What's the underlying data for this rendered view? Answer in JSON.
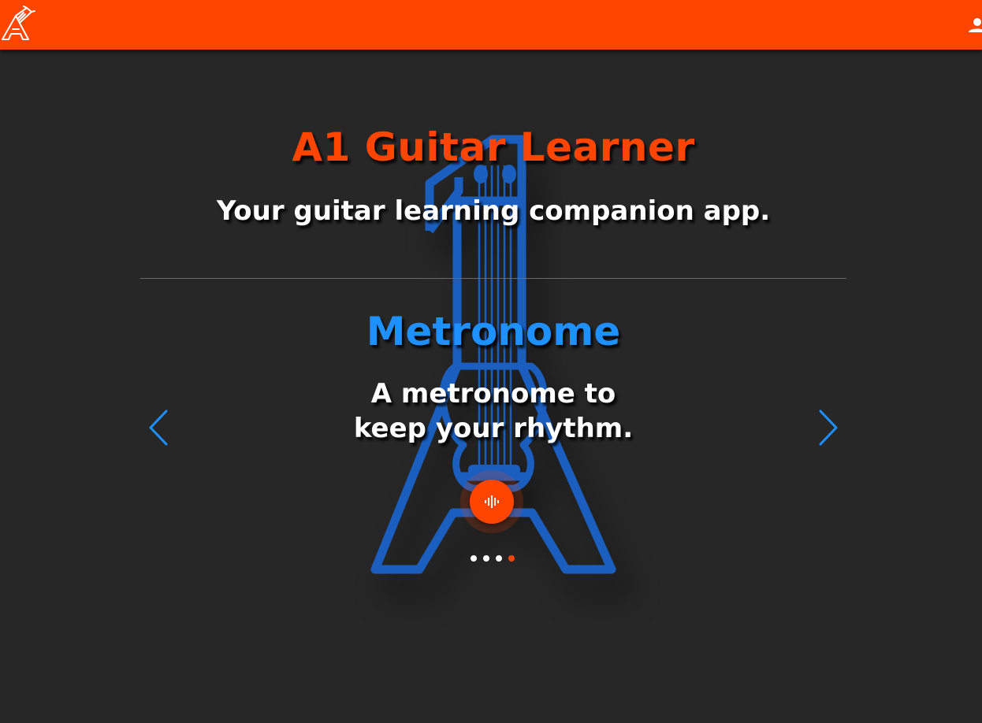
{
  "header": {
    "logo_icon": "guitar-a-logo-icon",
    "account_icon": "person-icon"
  },
  "hero": {
    "title": "A1 Guitar Learner",
    "subtitle": "Your guitar learning companion app."
  },
  "carousel": {
    "slide_title": "Metronome",
    "slide_description": "A metronome to keep your rhythm.",
    "prev_icon": "chevron-left-icon",
    "next_icon": "chevron-right-icon",
    "action_icon": "audio-waveform-icon",
    "slide_count": 4,
    "active_slide": 4
  },
  "colors": {
    "accent": "#ff4500",
    "secondary": "#1e90ff",
    "background": "#272727",
    "art_blue": "#1a5fbf",
    "text": "#ffffff"
  }
}
